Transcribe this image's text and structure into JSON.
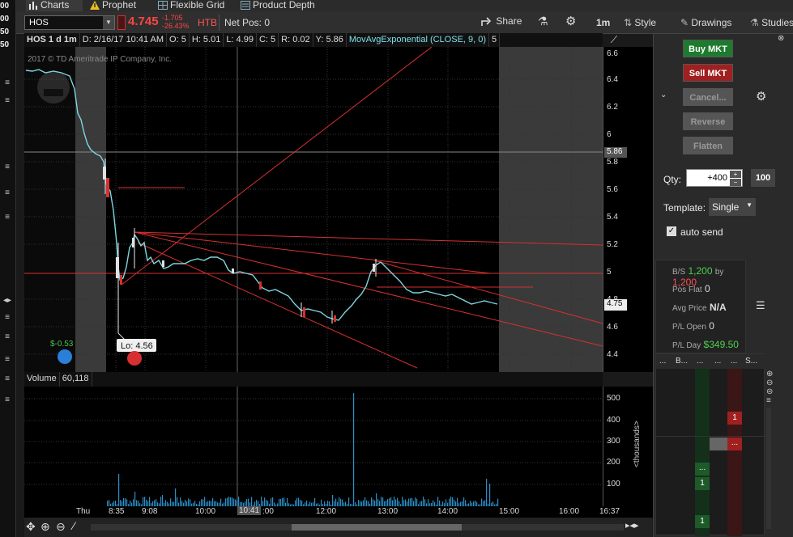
{
  "left_strip": {
    "prices": [
      "00",
      "00",
      "50",
      "50"
    ]
  },
  "tabs": [
    {
      "label": "Charts",
      "icon": "bars-icon"
    },
    {
      "label": "Prophet",
      "icon": "warning-icon"
    },
    {
      "label": "Flexible Grid",
      "icon": "grid-icon"
    },
    {
      "label": "Product Depth",
      "icon": "depth-icon"
    }
  ],
  "toolbar": {
    "symbol": "HOS",
    "last_price": "4.745",
    "change": "-1.705",
    "change_pct": "-26.43%",
    "htb": "HTB",
    "net_pos": "Net Pos: 0",
    "share": "Share",
    "timeframe": "1m",
    "style": "Style",
    "drawings": "Drawings",
    "studies": "Studies"
  },
  "chart_header": {
    "title": "HOS 1 d 1m",
    "date": "D: 2/16/17 10:41 AM",
    "open": "O: 5",
    "high": "H: 5.01",
    "low": "L: 4.99",
    "close": "C: 5",
    "range": "R: 0.02",
    "y": "Y: 5.86",
    "study": "MovAvgExponential (CLOSE, 9, 0)",
    "study_num": "5",
    "copyright": "2017 © TD Ameritrade IP Company, Inc."
  },
  "price_axis": {
    "ticks": [
      "6.6",
      "6.4",
      "6.2",
      "6",
      "5.8",
      "5.6",
      "5.4",
      "5.2",
      "5",
      "4.8",
      "4.6",
      "4.4"
    ],
    "marker_586": "5.86",
    "marker_475": "4.75",
    "lo_label": "Lo: 4.56",
    "dividend_label": "$-0.53"
  },
  "volume": {
    "label": "Volume",
    "value": "60,118",
    "ticks": [
      "500",
      "400",
      "300",
      "200",
      "100"
    ],
    "unit": "<thousands>"
  },
  "time_axis": {
    "ticks": [
      "Thu",
      "8:35",
      "9:08",
      "10:00",
      "10:41",
      ":00",
      "12:00",
      "13:00",
      "14:00",
      "15:00",
      "16:00",
      "16:37"
    ]
  },
  "trade_panel": {
    "buy": "Buy MKT",
    "sell": "Sell MKT",
    "cancel": "Cancel...",
    "reverse": "Reverse",
    "flatten": "Flatten",
    "qty_label": "Qty:",
    "qty_value": "+400",
    "qty_preset": "100",
    "template_label": "Template:",
    "template_value": "Single",
    "auto_send": "auto send",
    "bs_label": "B/S",
    "bs_value1": "1,200",
    "bs_by": "by",
    "bs_value2": "1,200",
    "pos_flat_label": "Pos Flat",
    "pos_flat_value": "0",
    "avg_price_label": "Avg Price",
    "avg_price_value": "N/A",
    "pl_open_label": "P/L Open",
    "pl_open_value": "0",
    "pl_day_label": "P/L Day",
    "pl_day_value": "$349.50"
  },
  "ladder": {
    "headers": [
      "...",
      "B...",
      "...",
      "...",
      "...",
      "S..."
    ],
    "cells": [
      {
        "col": "sell",
        "text": "1"
      },
      {
        "col": "sell",
        "text": "..."
      },
      {
        "col": "buy",
        "text": "..."
      },
      {
        "col": "buy",
        "text": "1"
      },
      {
        "col": "buy",
        "text": "1"
      }
    ]
  },
  "colors": {
    "buy": "#1e7a2e",
    "sell": "#a02020",
    "price_line": "#7fd6e0",
    "trend": "#d83030",
    "volume": "#2a8fc8"
  }
}
